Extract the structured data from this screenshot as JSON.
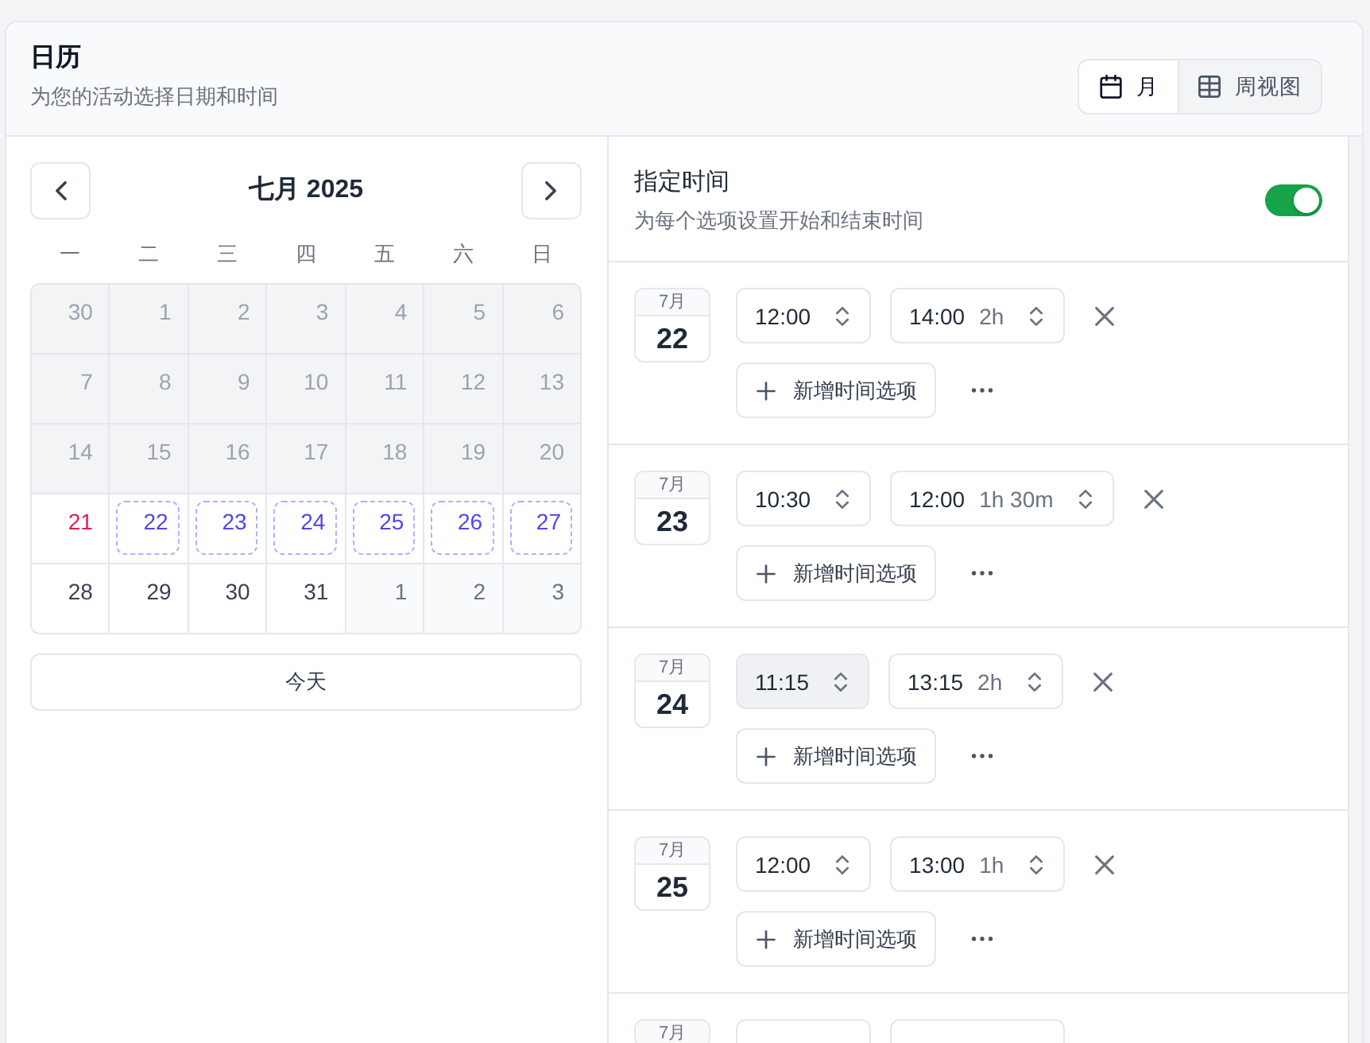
{
  "header": {
    "title": "日历",
    "subtitle": "为您的活动选择日期和时间",
    "views": [
      {
        "kind": "month",
        "label": "月",
        "selected": true
      },
      {
        "kind": "week",
        "label": "周视图",
        "selected": false
      }
    ]
  },
  "calendar": {
    "month_title": "七月 2025",
    "weekdays": [
      "一",
      "二",
      "三",
      "四",
      "五",
      "六",
      "日"
    ],
    "weeks": [
      [
        {
          "label": "30",
          "kind": "past",
          "selected": false
        },
        {
          "label": "1",
          "kind": "past",
          "selected": false
        },
        {
          "label": "2",
          "kind": "past",
          "selected": false
        },
        {
          "label": "3",
          "kind": "past",
          "selected": false
        },
        {
          "label": "4",
          "kind": "past",
          "selected": false
        },
        {
          "label": "5",
          "kind": "past",
          "selected": false
        },
        {
          "label": "6",
          "kind": "past",
          "selected": false
        }
      ],
      [
        {
          "label": "7",
          "kind": "past",
          "selected": false
        },
        {
          "label": "8",
          "kind": "past",
          "selected": false
        },
        {
          "label": "9",
          "kind": "past",
          "selected": false
        },
        {
          "label": "10",
          "kind": "past",
          "selected": false
        },
        {
          "label": "11",
          "kind": "past",
          "selected": false
        },
        {
          "label": "12",
          "kind": "past",
          "selected": false
        },
        {
          "label": "13",
          "kind": "past",
          "selected": false
        }
      ],
      [
        {
          "label": "14",
          "kind": "past",
          "selected": false
        },
        {
          "label": "15",
          "kind": "past",
          "selected": false
        },
        {
          "label": "16",
          "kind": "past",
          "selected": false
        },
        {
          "label": "17",
          "kind": "past",
          "selected": false
        },
        {
          "label": "18",
          "kind": "past",
          "selected": false
        },
        {
          "label": "19",
          "kind": "past",
          "selected": false
        },
        {
          "label": "20",
          "kind": "past",
          "selected": false
        }
      ],
      [
        {
          "label": "21",
          "kind": "today",
          "selected": false
        },
        {
          "label": "22",
          "kind": "current",
          "selected": true
        },
        {
          "label": "23",
          "kind": "current",
          "selected": true
        },
        {
          "label": "24",
          "kind": "current",
          "selected": true
        },
        {
          "label": "25",
          "kind": "current",
          "selected": true
        },
        {
          "label": "26",
          "kind": "current",
          "selected": true
        },
        {
          "label": "27",
          "kind": "current",
          "selected": true
        }
      ],
      [
        {
          "label": "28",
          "kind": "current",
          "selected": false
        },
        {
          "label": "29",
          "kind": "current",
          "selected": false
        },
        {
          "label": "30",
          "kind": "current",
          "selected": false
        },
        {
          "label": "31",
          "kind": "current",
          "selected": false
        },
        {
          "label": "1",
          "kind": "next",
          "selected": false
        },
        {
          "label": "2",
          "kind": "next",
          "selected": false
        },
        {
          "label": "3",
          "kind": "next",
          "selected": false
        }
      ]
    ],
    "today_button": "今天"
  },
  "times": {
    "title": "指定时间",
    "subtitle": "为每个选项设置开始和结束时间",
    "toggle": {
      "on": true
    },
    "dates": [
      {
        "month": "7月",
        "day": "22",
        "slots": [
          {
            "start": "12:00",
            "start_hovered": false,
            "end": "14:00",
            "duration": "2h"
          }
        ],
        "add_label": "新增时间选项"
      },
      {
        "month": "7月",
        "day": "23",
        "slots": [
          {
            "start": "10:30",
            "start_hovered": false,
            "end": "12:00",
            "duration": "1h 30m"
          }
        ],
        "add_label": "新增时间选项"
      },
      {
        "month": "7月",
        "day": "24",
        "slots": [
          {
            "start": "11:15",
            "start_hovered": true,
            "end": "13:15",
            "duration": "2h"
          }
        ],
        "add_label": "新增时间选项"
      },
      {
        "month": "7月",
        "day": "25",
        "slots": [
          {
            "start": "12:00",
            "start_hovered": false,
            "end": "13:00",
            "duration": "1h"
          }
        ],
        "add_label": "新增时间选项"
      },
      {
        "month": "7月",
        "slots": [
          {
            "start_hovered": false
          }
        ]
      }
    ]
  }
}
